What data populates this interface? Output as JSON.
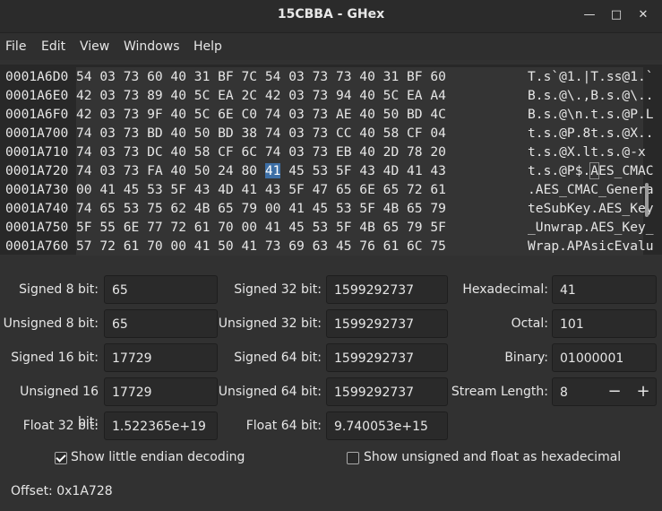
{
  "window": {
    "title": "15CBBA - GHex",
    "minimize_icon": "minimize-icon",
    "maximize_icon": "maximize-icon",
    "close_icon": "close-icon"
  },
  "menu": [
    "File",
    "Edit",
    "View",
    "Windows",
    "Help"
  ],
  "hex_rows": [
    {
      "offset": "0001A6D0",
      "hex": "54 03 73 60 40 31 BF 7C 54 03 73 73 40 31 BF 60",
      "ascii": "T.s`@1.|T.ss@1.`"
    },
    {
      "offset": "0001A6E0",
      "hex": "42 03 73 89 40 5C EA 2C 42 03 73 94 40 5C EA A4",
      "ascii": "B.s.@\\.,B.s.@\\.."
    },
    {
      "offset": "0001A6F0",
      "hex": "42 03 73 9F 40 5C 6E C0 74 03 73 AE 40 50 BD 4C",
      "ascii": "B.s.@\\n.t.s.@P.L"
    },
    {
      "offset": "0001A700",
      "hex": "74 03 73 BD 40 50 BD 38 74 03 73 CC 40 58 CF 04",
      "ascii": "t.s.@P.8t.s.@X.."
    },
    {
      "offset": "0001A710",
      "hex": "74 03 73 DC 40 58 CF 6C 74 03 73 EB 40 2D 78 20",
      "ascii": "t.s.@X.lt.s.@-x "
    },
    {
      "offset": "0001A720",
      "hex_before": "74 03 73 FA 40 50 24 80 ",
      "hex_sel": "41",
      "hex_after": " 45 53 5F 43 4D 41 43",
      "ascii_before": "t.s.@P$.",
      "ascii_sel": "A",
      "ascii_after": "ES_CMAC"
    },
    {
      "offset": "0001A730",
      "hex": "00 41 45 53 5F 43 4D 41 43 5F 47 65 6E 65 72 61",
      "ascii": ".AES_CMAC_Genera"
    },
    {
      "offset": "0001A740",
      "hex": "74 65 53 75 62 4B 65 79 00 41 45 53 5F 4B 65 79",
      "ascii": "teSubKey.AES_Key"
    },
    {
      "offset": "0001A750",
      "hex": "5F 55 6E 77 72 61 70 00 41 45 53 5F 4B 65 79 5F",
      "ascii": "_Unwrap.AES_Key_"
    },
    {
      "offset": "0001A760",
      "hex": "57 72 61 70 00 41 50 41 73 69 63 45 76 61 6C 75",
      "ascii": "Wrap.APAsicEvalu"
    }
  ],
  "decoding": {
    "signed8": {
      "label": "Signed 8 bit:",
      "value": "65"
    },
    "unsigned8": {
      "label": "Unsigned 8 bit:",
      "value": "65"
    },
    "signed16": {
      "label": "Signed 16 bit:",
      "value": "17729"
    },
    "unsigned16": {
      "label": "Unsigned 16 bit:",
      "value": "17729"
    },
    "float32": {
      "label": "Float 32 bit:",
      "value": "1.522365e+19"
    },
    "signed32": {
      "label": "Signed 32 bit:",
      "value": "1599292737"
    },
    "unsigned32": {
      "label": "Unsigned 32 bit:",
      "value": "1599292737"
    },
    "signed64": {
      "label": "Signed 64 bit:",
      "value": "1599292737"
    },
    "unsigned64": {
      "label": "Unsigned 64 bit:",
      "value": "1599292737"
    },
    "float64": {
      "label": "Float 64 bit:",
      "value": "9.740053e+15"
    },
    "hexadecimal": {
      "label": "Hexadecimal:",
      "value": "41"
    },
    "octal": {
      "label": "Octal:",
      "value": "101"
    },
    "binary": {
      "label": "Binary:",
      "value": "01000001"
    },
    "stream_length": {
      "label": "Stream Length:",
      "value": "8",
      "minus": "−",
      "plus": "+"
    }
  },
  "options": {
    "little_endian": {
      "label": "Show little endian decoding",
      "checked": true
    },
    "unsigned_hex": {
      "label": "Show unsigned and float as hexadecimal",
      "checked": false
    }
  },
  "status": {
    "offset": "Offset: 0x1A728"
  }
}
